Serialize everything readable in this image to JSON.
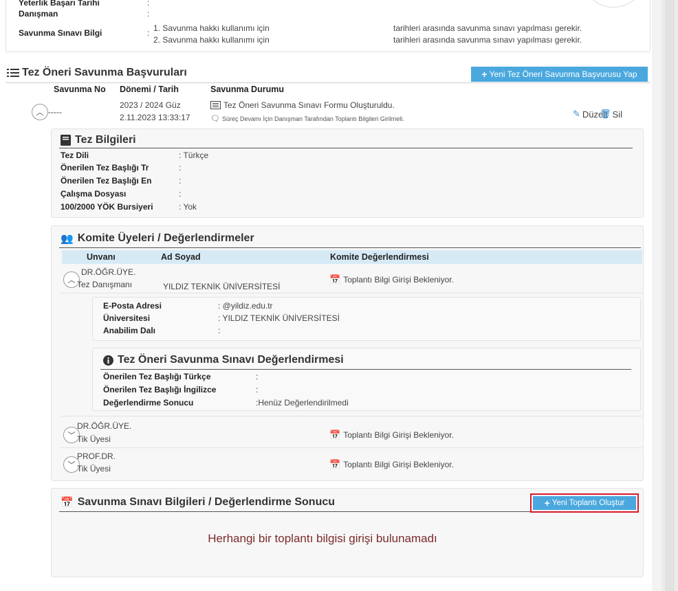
{
  "top": {
    "yeterlik_label": "Yeterlik Başarı Tarihi",
    "yeterlik_colon": ":",
    "danisman_label": "Danışman",
    "danisman_colon": ":",
    "savunma_label": "Savunma Sınavı Bilgi",
    "savunma_colon": ":",
    "info_line1_a": "1. Savunma hakkı kullanımı için",
    "info_line1_b": "tarihleri arasında savunma sınavı yapılması gerekir.",
    "info_line2_a": "2. Savunma hakkı kullanımı için",
    "info_line2_b": "tarihleri arasında savunma sınavı yapılması gerekir."
  },
  "section": {
    "title": "Tez Öneri Savunma Başvuruları",
    "new_button": "Yeni Tez Öneri Savunma Başvurusu Yap",
    "columns": [
      "Savunma No",
      "Dönemi / Tarih",
      "Savunma Durumu"
    ]
  },
  "application": {
    "number": "-----",
    "term": "2023 / 2024 Güz",
    "date": "2.11.2023 13:33:17",
    "status_main": "Tez Öneri Savunma Sınavı Formu Oluşturuldu.",
    "status_sub": "Süreç Devamı İçin Danışman Tarafından Toplantı Bilgileri Girilmeli.",
    "edit_label": "Düzelt",
    "delete_label": "Sil"
  },
  "thesis": {
    "title": "Tez Bilgileri",
    "fields": [
      {
        "label": "Tez Dili",
        "value": ": Türkçe"
      },
      {
        "label": "Önerilen Tez Başlığı Tr",
        "value": ":"
      },
      {
        "label": "Önerilen Tez Başlığı En",
        "value": ":"
      },
      {
        "label": "Çalışma Dosyası",
        "value": ":"
      },
      {
        "label": "100/2000 YÖK Bursiyeri",
        "value": ": Yok"
      }
    ]
  },
  "committee": {
    "title": "Komite Üyeleri / Değerlendirmeler",
    "columns": [
      "Unvanı",
      "Ad Soyad",
      "Komite Değerlendirmesi"
    ],
    "members": [
      {
        "title": "DR.ÖĞR.ÜYE.",
        "role": "Tez Danışmanı",
        "university_small": "YILDIZ TEKNİK ÜNİVERSİTESİ",
        "status": "Toplantı Bilgi Girişi Bekleniyor."
      },
      {
        "title": "DR.ÖĞR.ÜYE.",
        "role": "Tik Üyesi",
        "status": "Toplantı Bilgi Girişi Bekleniyor."
      },
      {
        "title": "PROF.DR.",
        "role": "Tik Üyesi",
        "status": "Toplantı Bilgi Girişi Bekleniyor."
      }
    ],
    "detail": {
      "email_label": "E-Posta Adresi",
      "email_value": ":              @yildiz.edu.tr",
      "uni_label": "Üniversitesi",
      "uni_value": ": YILDIZ TEKNİK ÜNİVERSİTESİ",
      "dept_label": "Anabilim Dalı",
      "dept_value": ":"
    },
    "evaluation": {
      "title": "Tez Öneri Savunma Sınavı Değerlendirmesi",
      "fields": [
        {
          "label": "Önerilen Tez Başlığı Türkçe",
          "value": ":"
        },
        {
          "label": "Önerilen Tez Başlığı İngilizce",
          "value": ":"
        },
        {
          "label": "Değerlendirme Sonucu",
          "value": ":Henüz Değerlendirilmedi"
        }
      ]
    }
  },
  "meeting": {
    "title": "Savunma Sınavı Bilgileri / Değerlendirme Sonucu",
    "new_button": "Yeni Toplantı Oluştur",
    "empty_message": "Herhangi bir toplantı bilgisi girişi bulunamadı"
  },
  "colors": {
    "accent": "#4aa8de",
    "header_bg": "#d6eaf6",
    "highlight": "#d91a2a",
    "empty_text": "#7b2a2a"
  }
}
